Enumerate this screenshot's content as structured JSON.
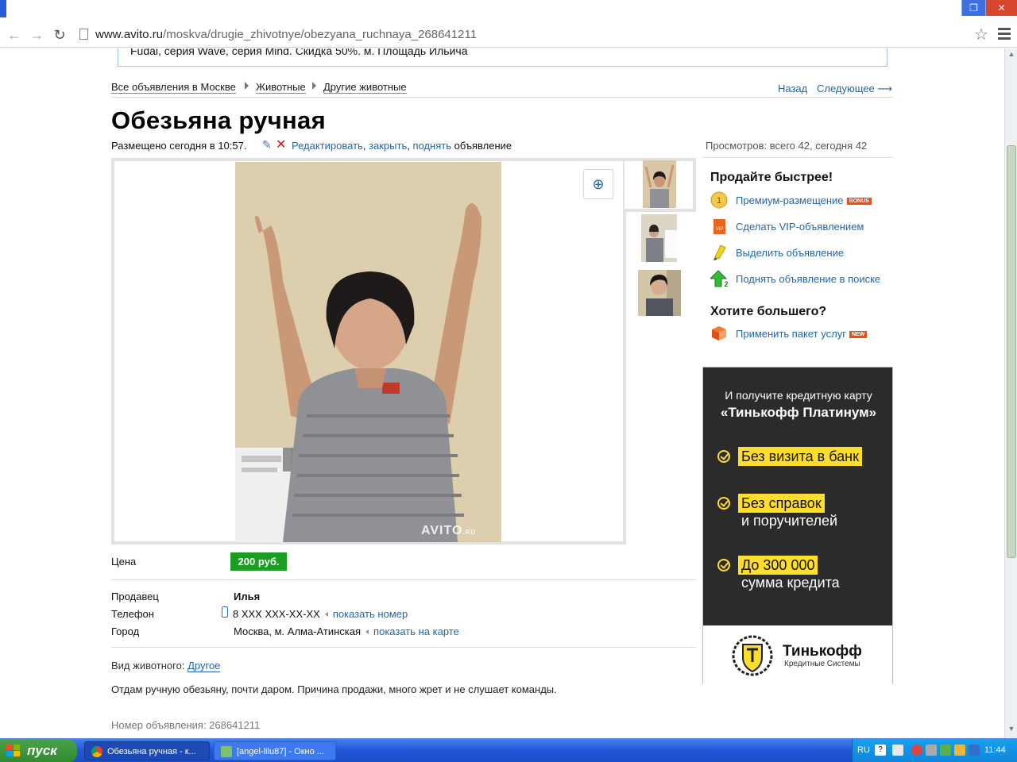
{
  "browser": {
    "url_host": "www.avito.ru",
    "url_path": "/moskva/drugie_zhivotnye/obezyana_ruchnaya_268641211"
  },
  "top_banner": "Fudai, серия Wave, серия Mind. Скидка 50%. м. Площадь Ильича",
  "breadcrumbs": [
    "Все объявления в Москве",
    "Животные",
    "Другие животные"
  ],
  "nav": {
    "back": "Назад",
    "next": "Следующее ⟶"
  },
  "listing": {
    "title": "Обезьяна ручная",
    "posted": "Размещено сегодня в 10:57.",
    "edit_links": [
      "Редактировать",
      "закрыть",
      "поднять"
    ],
    "edit_suffix": "объявление",
    "views": "Просмотров: всего 42, сегодня 42",
    "watermark": "AVITO",
    "watermark_suffix": ".RU",
    "price_label": "Цена",
    "price": "200 руб.",
    "seller_label": "Продавец",
    "seller": "Илья",
    "phone_label": "Телефон",
    "phone": "8 XXX XXX-XX-XX",
    "show_phone": "показать номер",
    "city_label": "Город",
    "city": "Москва, м. Алма-Атинская",
    "show_map": "показать на карте",
    "animal_type_label": "Вид животного:",
    "animal_type": "Другое",
    "description": "Отдам ручную обезьяну, почти даром. Причина продажи, много жрет и не слушает команды.",
    "ad_number": "Номер объявления: 268641211"
  },
  "sidebar": {
    "sell_faster": "Продайте быстрее!",
    "services": [
      {
        "label": "Премиум-размещение",
        "badge": "BONUS",
        "icon": "premium-coin-icon"
      },
      {
        "label": "Сделать VIP-объявлением",
        "icon": "vip-icon"
      },
      {
        "label": "Выделить объявление",
        "icon": "highlighter-icon"
      },
      {
        "label": "Поднять объявление в поиске",
        "icon": "up-arrow-icon"
      }
    ],
    "want_more": "Хотите большего?",
    "package": {
      "label": "Применить пакет услуг",
      "badge": "NEW",
      "icon": "package-box-icon"
    }
  },
  "ad_banner": {
    "line1": "И получите кредитную карту",
    "line2": "«Тинькофф Платинум»",
    "items": [
      {
        "highlight": "Без визита в банк",
        "sub": ""
      },
      {
        "highlight": "Без справок",
        "sub": "и поручителей"
      },
      {
        "highlight": "До 300 000",
        "sub": "сумма кредита"
      }
    ],
    "brand": "Тинькофф",
    "brand_sub": "Кредитные Системы",
    "colors": {
      "accent": "#ffdd2d",
      "background": "#2b2b2b"
    }
  },
  "taskbar": {
    "start": "пуск",
    "tasks": [
      "Обезьяна ручная - к...",
      "[angel-lilu87] - Окно ..."
    ],
    "lang": "RU",
    "clock": "11:44"
  },
  "colors": {
    "link": "#2266aa",
    "price_bg": "#1a9d22"
  }
}
